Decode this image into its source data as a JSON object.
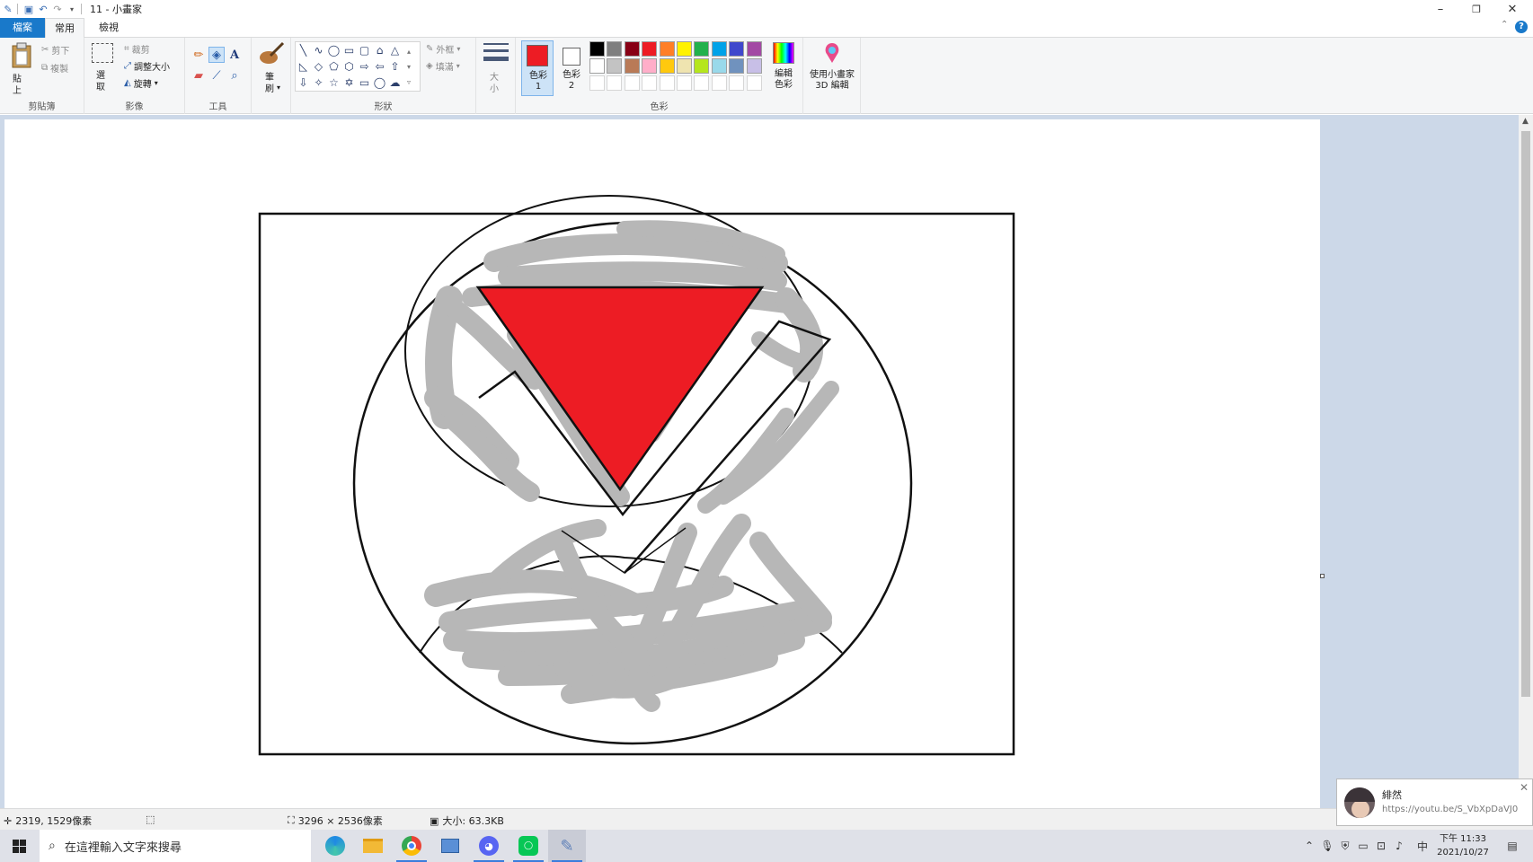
{
  "window": {
    "title": "11 - 小畫家",
    "minimize": "–",
    "restore": "❐",
    "close": "✕"
  },
  "tabs": [
    {
      "label": "檔案"
    },
    {
      "label": "常用"
    },
    {
      "label": "檢視"
    }
  ],
  "ribbon": {
    "clipboard": {
      "label": "剪貼簿",
      "paste": "貼上",
      "cut": "剪下",
      "copy": "複製"
    },
    "image": {
      "label": "影像",
      "select": "選取",
      "crop": "裁剪",
      "resize": "調整大小",
      "rotate": "旋轉"
    },
    "tools": {
      "label": "工具"
    },
    "brushes": {
      "label": "筆刷"
    },
    "shapes": {
      "label": "形狀",
      "outline": "外框",
      "fill": "填滿"
    },
    "size": {
      "label": "大小"
    },
    "colors": {
      "label": "色彩",
      "color1": "色彩 1",
      "color2": "色彩 2",
      "edit": "編輯色彩",
      "paint3d": "使用小畫家 3D 編輯",
      "color1_value": "#ed1c24",
      "color2_value": "#ffffff",
      "palette_row1": [
        "#000000",
        "#7f7f7f",
        "#880015",
        "#ed1c24",
        "#ff7f27",
        "#fff200",
        "#22b14c",
        "#00a2e8",
        "#3f48cc",
        "#a349a4"
      ],
      "palette_row2": [
        "#ffffff",
        "#c3c3c3",
        "#b97a57",
        "#ffaec9",
        "#ffc90e",
        "#efe4b0",
        "#b5e61d",
        "#99d9ea",
        "#7092be",
        "#c8bfe7"
      ]
    }
  },
  "status": {
    "cursor_pos": "2319, 1529像素",
    "image_size": "3296 × 2536像素",
    "file_size": "大小: 63.3KB"
  },
  "taskbar": {
    "search_placeholder": "在這裡輸入文字來搜尋",
    "time": "下午 11:33",
    "date": "2021/10/27",
    "ime": "中"
  },
  "notification": {
    "name": "緋然",
    "message": "https://youtu.be/S_VbXpDaVJ0"
  }
}
